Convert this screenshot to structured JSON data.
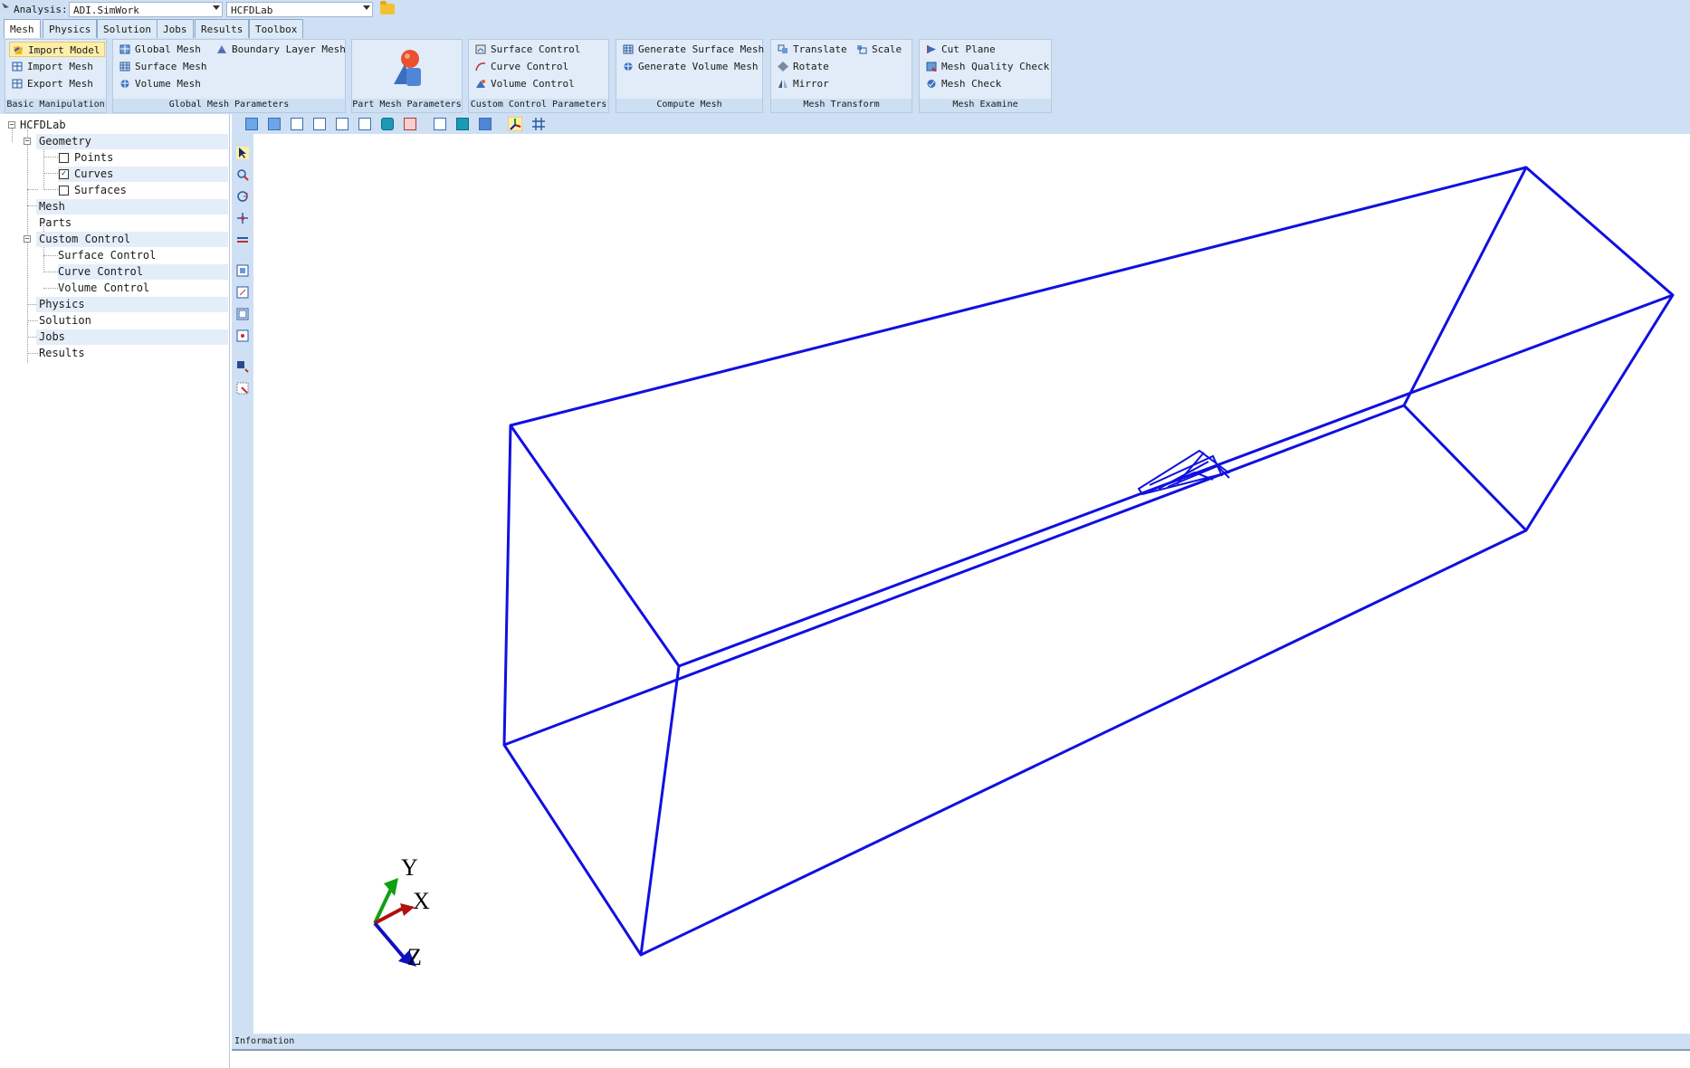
{
  "analysis": {
    "label": "Analysis:",
    "value": "ADI.SimWork",
    "project": "HCFDLab"
  },
  "tabs": [
    "Mesh",
    "Physics",
    "Solution",
    "Jobs",
    "Results",
    "Toolbox"
  ],
  "ribbon": {
    "basic": {
      "title": "Basic Manipulation",
      "import_model": "Import Model",
      "import_mesh": "Import Mesh",
      "export_mesh": "Export Mesh"
    },
    "global": {
      "title": "Global Mesh Parameters",
      "global_mesh": "Global Mesh",
      "surface_mesh": "Surface Mesh",
      "volume_mesh": "Volume Mesh",
      "boundary_layer": "Boundary Layer Mesh"
    },
    "part": {
      "title": "Part Mesh Parameters"
    },
    "custom": {
      "title": "Custom Control Parameters",
      "surface": "Surface Control",
      "curve": "Curve Control",
      "volume": "Volume Control"
    },
    "compute": {
      "title": "Compute Mesh",
      "gen_surface": "Generate Surface Mesh",
      "gen_volume": "Generate Volume Mesh"
    },
    "transform": {
      "title": "Mesh Transform",
      "translate": "Translate",
      "scale": "Scale",
      "rotate": "Rotate",
      "mirror": "Mirror"
    },
    "examine": {
      "title": "Mesh Examine",
      "cut_plane": "Cut Plane",
      "quality": "Mesh Quality Check",
      "check": "Mesh Check"
    }
  },
  "tree": {
    "root": "HCFDLab",
    "geometry": "Geometry",
    "points": "Points",
    "curves": "Curves",
    "curves_checked": "✓",
    "surfaces": "Surfaces",
    "mesh": "Mesh",
    "parts": "Parts",
    "custom_control": "Custom Control",
    "surface_control": "Surface Control",
    "curve_control": "Curve Control",
    "volume_control": "Volume Control",
    "physics": "Physics",
    "solution": "Solution",
    "jobs": "Jobs",
    "results": "Results"
  },
  "axes": {
    "y": "Y",
    "x": "X",
    "z": "Z"
  },
  "info": {
    "title": "Information"
  },
  "colors": {
    "wireframe": "#1010e0",
    "axis_x": "#b01010",
    "axis_y": "#10a010",
    "axis_z": "#1010c0",
    "chrome": "#cfe0f4"
  }
}
